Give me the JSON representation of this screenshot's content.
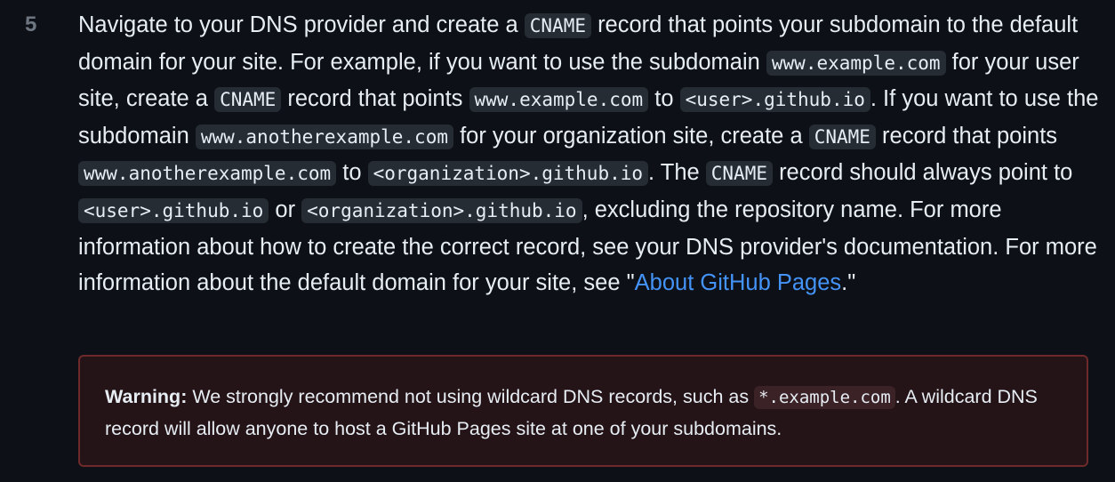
{
  "step": {
    "number": "5"
  },
  "paragraph": {
    "t1": "Navigate to your DNS provider and create a ",
    "c1": "CNAME",
    "t2": " record that points your subdomain to the default domain for your site. For example, if you want to use the subdomain ",
    "c2": "www.example.com",
    "t3": " for your user site, create a ",
    "c3": "CNAME",
    "t4": " record that points ",
    "c4": "www.example.com",
    "t5": " to ",
    "c5": "<user>.github.io",
    "t6": ". If you want to use the subdomain ",
    "c6": "www.anotherexample.com",
    "t7": " for your organization site, create a ",
    "c7": "CNAME",
    "t8": " record that points ",
    "c8": "www.anotherexample.com",
    "t9": " to ",
    "c9": "<organization>.github.io",
    "t10": ". The ",
    "c10": "CNAME",
    "t11": " record should always point to ",
    "c11": "<user>.github.io",
    "t12": " or ",
    "c12": "<organization>.github.io",
    "t13": ", excluding the repository name. For more information about how to create the correct record, see your DNS provider's documentation. For more information about the default domain for your site, see \"",
    "link": "About GitHub Pages",
    "t14": ".\""
  },
  "warning": {
    "label": "Warning:",
    "t1": " We strongly recommend not using wildcard DNS records, such as ",
    "code": "*.example.com",
    "t2": ". A wildcard DNS record will allow anyone to host a GitHub Pages site at one of your subdomains."
  },
  "colors": {
    "background": "#0d1117",
    "link": "#4493f8",
    "warning_border": "#6e2a2a",
    "warning_background": "#251417"
  }
}
